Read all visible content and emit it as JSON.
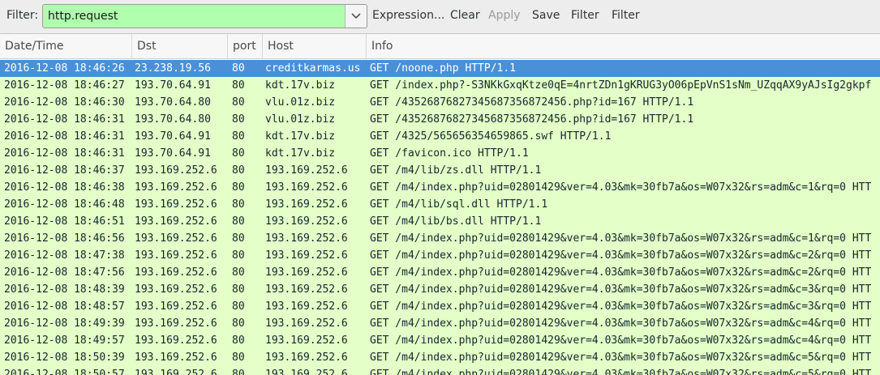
{
  "toolbar": {
    "filter_label": "Filter:",
    "filter_value": "http.request",
    "dropdown_icon": "chevron-down-icon",
    "buttons": [
      "Expression...",
      "Clear",
      "Apply",
      "Save",
      "Filter",
      "Filter"
    ],
    "disabled_buttons": [
      "Apply"
    ],
    "filter_bg_color": "#afffaf"
  },
  "columns": [
    "Date/Time",
    "Dst",
    "port",
    "Host",
    "Info"
  ],
  "colors": {
    "row_bg": "#e4ffc7",
    "selected_bg": "#4a90d9"
  },
  "selected_row": 0,
  "rows": [
    {
      "date": "2016-12-08 18:46:26",
      "dst": "23.238.19.56",
      "port": "80",
      "host": "creditkarmas.us",
      "info": "GET /noone.php HTTP/1.1"
    },
    {
      "date": "2016-12-08 18:46:27",
      "dst": "193.70.64.91",
      "port": "80",
      "host": "kdt.17v.biz",
      "info": "GET /index.php?-S3NKkGxqKtze0qE=4nrtZDn1gKRUG3yO06pEpVnS1sNm_UZqqAX9yAJsIg2gkpf"
    },
    {
      "date": "2016-12-08 18:46:30",
      "dst": "193.70.64.80",
      "port": "80",
      "host": "vlu.01z.biz",
      "info": "GET /4352687682734568735687245б.php?id=167 HTTP/1.1"
    },
    {
      "date": "2016-12-08 18:46:31",
      "dst": "193.70.64.80",
      "port": "80",
      "host": "vlu.01z.biz",
      "info": "GET /43526876827345687356872456.php?id=167 HTTP/1.1"
    },
    {
      "date": "2016-12-08 18:46:31",
      "dst": "193.70.64.91",
      "port": "80",
      "host": "kdt.17v.biz",
      "info": "GET /4325/565656354659865.swf HTTP/1.1"
    },
    {
      "date": "2016-12-08 18:46:31",
      "dst": "193.70.64.91",
      "port": "80",
      "host": "kdt.17v.biz",
      "info": "GET /favicon.ico HTTP/1.1"
    },
    {
      "date": "2016-12-08 18:46:37",
      "dst": "193.169.252.6",
      "port": "80",
      "host": "193.169.252.6",
      "info": "GET /m4/lib/zs.dll HTTP/1.1"
    },
    {
      "date": "2016-12-08 18:46:38",
      "dst": "193.169.252.6",
      "port": "80",
      "host": "193.169.252.6",
      "info": "GET /m4/index.php?uid=02801429&ver=4.03&mk=30fb7a&os=W07x32&rs=adm&c=1&rq=0 HTT"
    },
    {
      "date": "2016-12-08 18:46:48",
      "dst": "193.169.252.6",
      "port": "80",
      "host": "193.169.252.6",
      "info": "GET /m4/lib/sql.dll HTTP/1.1"
    },
    {
      "date": "2016-12-08 18:46:51",
      "dst": "193.169.252.6",
      "port": "80",
      "host": "193.169.252.6",
      "info": "GET /m4/lib/bs.dll HTTP/1.1"
    },
    {
      "date": "2016-12-08 18:46:56",
      "dst": "193.169.252.6",
      "port": "80",
      "host": "193.169.252.6",
      "info": "GET /m4/index.php?uid=02801429&ver=4.03&mk=30fb7a&os=W07x32&rs=adm&c=1&rq=0 HTT"
    },
    {
      "date": "2016-12-08 18:47:38",
      "dst": "193.169.252.6",
      "port": "80",
      "host": "193.169.252.6",
      "info": "GET /m4/index.php?uid=02801429&ver=4.03&mk=30fb7a&os=W07x32&rs=adm&c=2&rq=0 HTT"
    },
    {
      "date": "2016-12-08 18:47:56",
      "dst": "193.169.252.6",
      "port": "80",
      "host": "193.169.252.6",
      "info": "GET /m4/index.php?uid=02801429&ver=4.03&mk=30fb7a&os=W07x32&rs=adm&c=2&rq=0 HTT"
    },
    {
      "date": "2016-12-08 18:48:39",
      "dst": "193.169.252.6",
      "port": "80",
      "host": "193.169.252.6",
      "info": "GET /m4/index.php?uid=02801429&ver=4.03&mk=30fb7a&os=W07x32&rs=adm&c=3&rq=0 HTT"
    },
    {
      "date": "2016-12-08 18:48:57",
      "dst": "193.169.252.6",
      "port": "80",
      "host": "193.169.252.6",
      "info": "GET /m4/index.php?uid=02801429&ver=4.03&mk=30fb7a&os=W07x32&rs=adm&c=3&rq=0 HTT"
    },
    {
      "date": "2016-12-08 18:49:39",
      "dst": "193.169.252.6",
      "port": "80",
      "host": "193.169.252.6",
      "info": "GET /m4/index.php?uid=02801429&ver=4.03&mk=30fb7a&os=W07x32&rs=adm&c=4&rq=0 HTT"
    },
    {
      "date": "2016-12-08 18:49:57",
      "dst": "193.169.252.6",
      "port": "80",
      "host": "193.169.252.6",
      "info": "GET /m4/index.php?uid=02801429&ver=4.03&mk=30fb7a&os=W07x32&rs=adm&c=4&rq=0 HTT"
    },
    {
      "date": "2016-12-08 18:50:39",
      "dst": "193.169.252.6",
      "port": "80",
      "host": "193.169.252.6",
      "info": "GET /m4/index.php?uid=02801429&ver=4.03&mk=30fb7a&os=W07x32&rs=adm&c=5&rq=0 HTT"
    },
    {
      "date": "2016-12-08 18:50:57",
      "dst": "193.169.252.6",
      "port": "80",
      "host": "193.169.252.6",
      "info": "GET /m4/index.php?uid=02801429&ver=4.03&mk=30fb7a&os=W07x32&rs=adm&c=5&rq=0 HTT"
    }
  ]
}
